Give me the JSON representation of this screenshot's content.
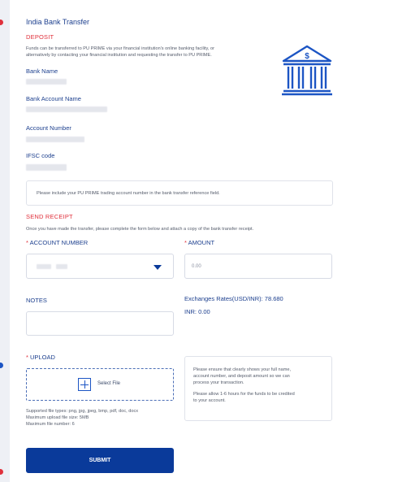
{
  "colors": {
    "primary": "#1c3f8e",
    "accent_red": "#e0313c",
    "button": "#0a3a9a",
    "background": "#eef0f5"
  },
  "header": {
    "title": "India Bank Transfer"
  },
  "deposit": {
    "heading": "DEPOSIT",
    "description_1": "Funds can be transferred to PU PRIME via your financial institution's online banking facility, or",
    "description_2": "alternatively by contacting your financial institution and requesting the transfer to PU PRIME.",
    "bank_icon": "bank-icon",
    "fields": [
      {
        "label": "Bank Name"
      },
      {
        "label": "Bank Account Name"
      },
      {
        "label": "Account Number"
      },
      {
        "label": "IFSC code"
      }
    ],
    "notice": "Please include your PU PRIME trading account number in the bank transfer reference field."
  },
  "receipt": {
    "heading": "SEND RECEIPT",
    "instructions": "Once you have made the transfer, please complete the form below and attach a copy of the bank transfer receipt.",
    "account_number": {
      "label": "ACCOUNT NUMBER",
      "required_mark": "*",
      "icon": "caret-down-icon"
    },
    "amount": {
      "label": "AMOUNT",
      "required_mark": "*",
      "placeholder": "0.00"
    },
    "notes": {
      "label": "NOTES",
      "value": ""
    },
    "exchange_rate": "Exchanges Rates(USD/INR): 78.680",
    "inr_amount": "INR: 0.00",
    "upload": {
      "label": "UPLOAD",
      "required_mark": "*",
      "button_label": "Select File",
      "icon": "plus-icon",
      "supported_types": "Supported file types: png, jpg, jpeg, bmp, pdf, doc, docx",
      "max_size": "Maximum upload file size: 5MB",
      "max_number": "Maximum file number: 6"
    },
    "info": {
      "line_1": "Please ensure that clearly shows your full name,",
      "line_2": "account number, and deposit amount so we can",
      "line_3": "process your transaction.",
      "line_4": "Please allow 1-6 hours for the funds to be credited",
      "line_5": "to your account."
    },
    "submit_label": "SUBMIT"
  }
}
